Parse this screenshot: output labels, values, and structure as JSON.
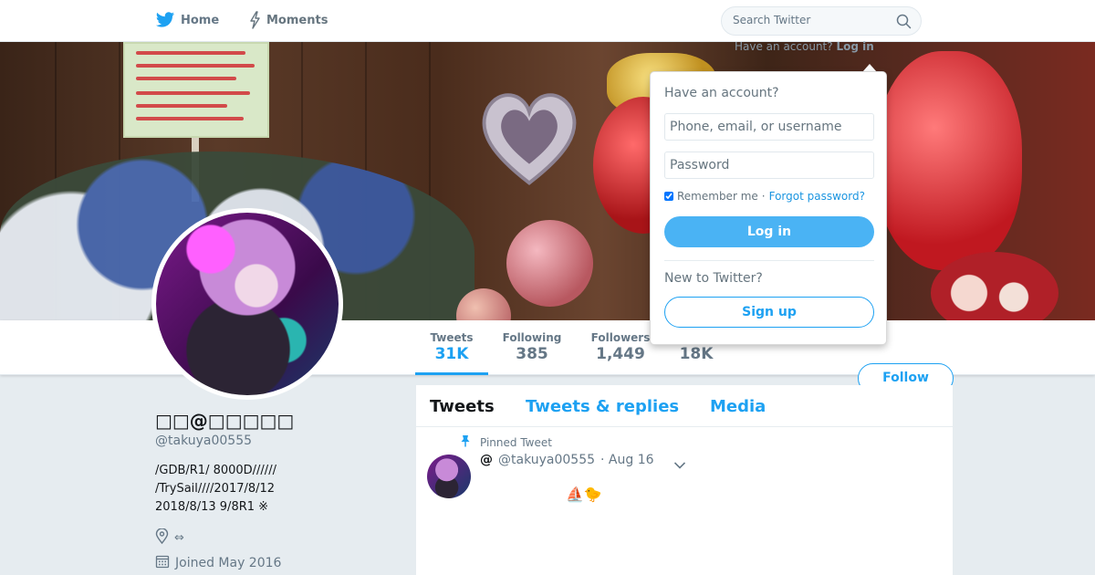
{
  "topnav": {
    "home_label": "Home",
    "moments_label": "Moments",
    "search_placeholder": "Search Twitter"
  },
  "login_link": {
    "prefix": "Have an account?",
    "link": "Log in"
  },
  "login_dropdown": {
    "title": "Have an account?",
    "username_placeholder": "Phone, email, or username",
    "password_placeholder": "Password",
    "remember_label": "Remember me",
    "separator": "·",
    "forgot_label": "Forgot password?",
    "login_button": "Log in",
    "new_label": "New to Twitter?",
    "signup_button": "Sign up"
  },
  "profile_nav": {
    "stats": [
      {
        "label": "Tweets",
        "value": "31K"
      },
      {
        "label": "Following",
        "value": "385"
      },
      {
        "label": "Followers",
        "value": "1,449"
      },
      {
        "label": "",
        "value": "18K"
      }
    ],
    "follow_button": "Follow"
  },
  "profile": {
    "name": "□□@□□□□□",
    "handle": "@takuya00555",
    "bio": "/GDB/R1/ 8000D//////\n/TrySail////2017/8/12\n2018/8/13 9/8R1 ※",
    "location": "⇔",
    "joined": "Joined May 2016"
  },
  "timeline": {
    "tabs": [
      "Tweets",
      "Tweets & replies",
      "Media"
    ],
    "pinned_label": "Pinned Tweet",
    "tweet": {
      "at": "@",
      "handle": "@takuya00555",
      "date": "· Aug 16",
      "body": "⛵🐤"
    }
  },
  "colors": {
    "accent": "#1da1f2",
    "login_button": "#4ab3f4",
    "background": "#e6ecf0"
  }
}
